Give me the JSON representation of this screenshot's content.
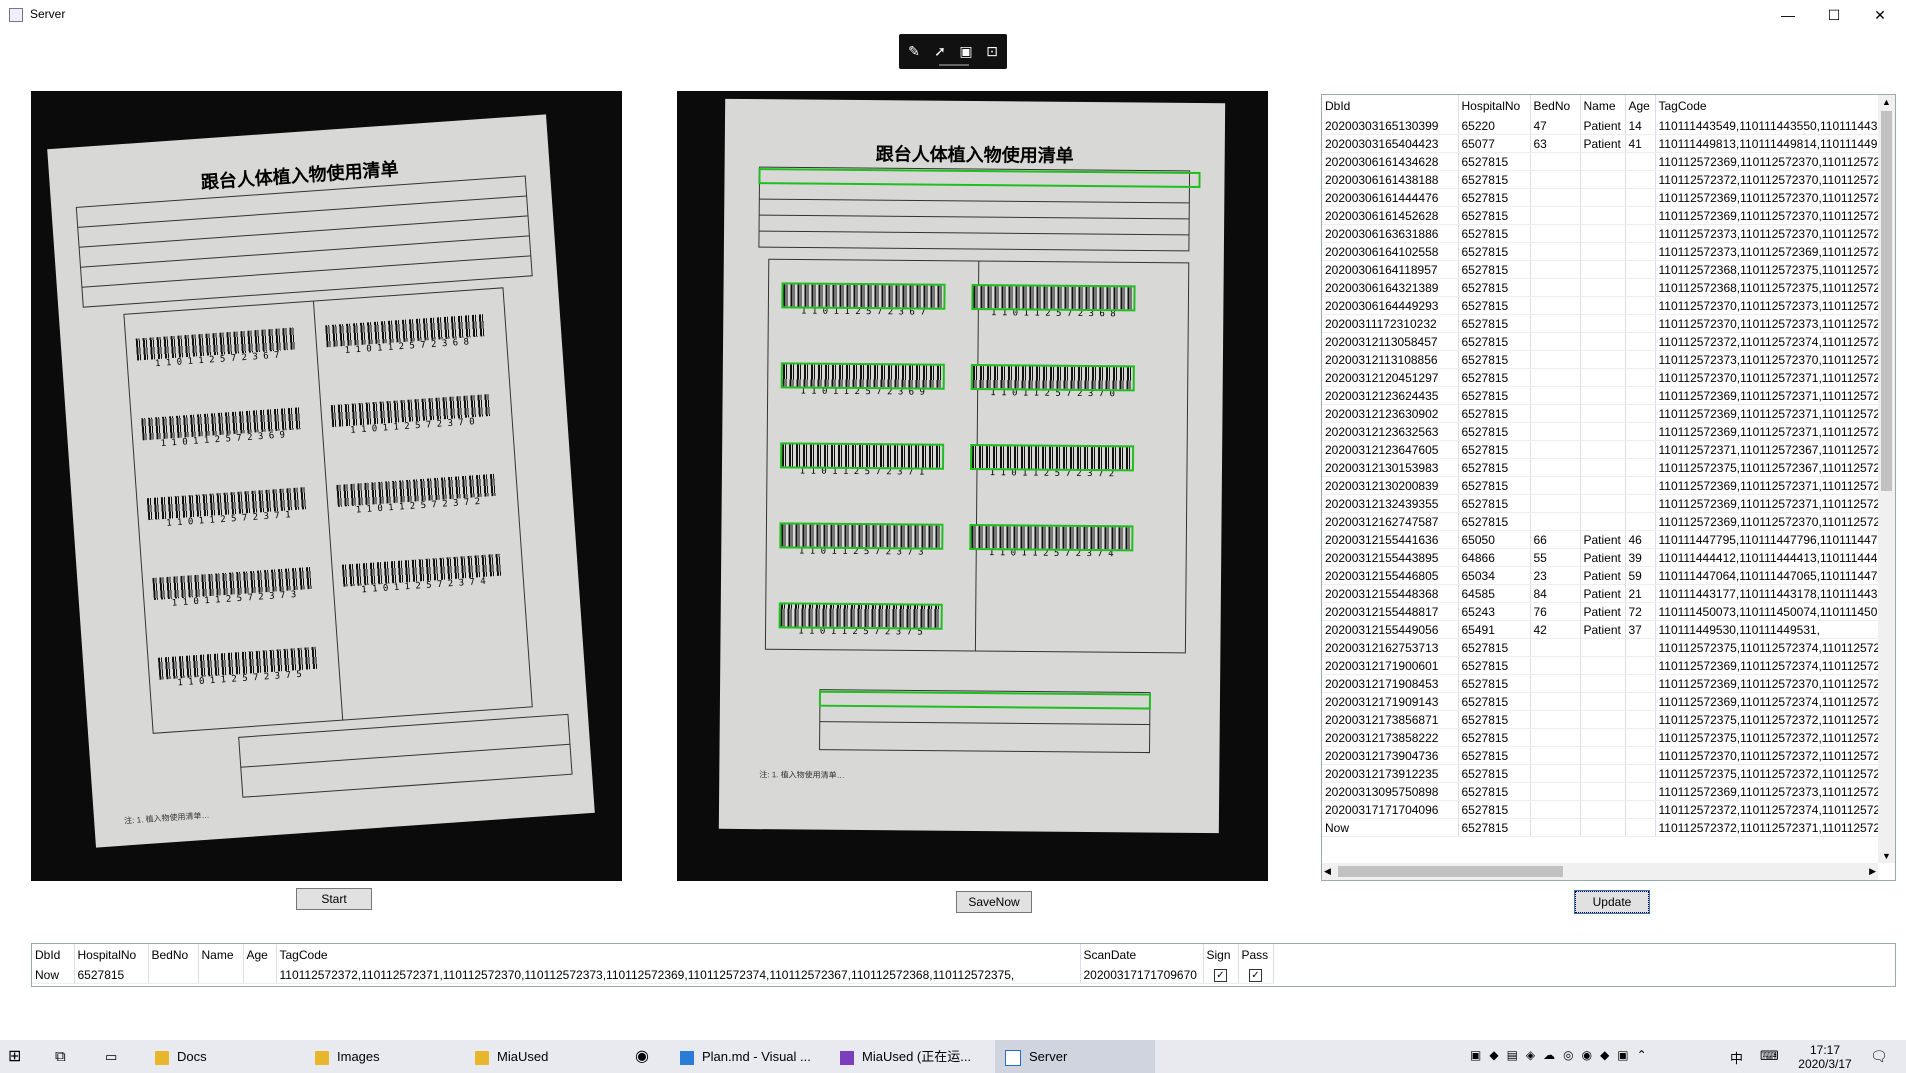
{
  "window": {
    "title": "Server",
    "minimize": "—",
    "maximize": "☐",
    "close": "✕"
  },
  "toolbar": {
    "icons": [
      "edit-doc-icon",
      "select-pointer-icon",
      "frame-icon",
      "presentation-icon"
    ]
  },
  "left_image": {
    "heading": "跟台人体植入物使用清单",
    "barcodes": [
      "1 1 0 1 1 2 5 7 2 3 6 7",
      "1 1 0 1 1 2 5 7 2 3 6 8",
      "1 1 0 1 1 2 5 7 2 3 6 9",
      "1 1 0 1 1 2 5 7 2 3 7 0",
      "1 1 0 1 1 2 5 7 2 3 7 1",
      "1 1 0 1 1 2 5 7 2 3 7 2",
      "1 1 0 1 1 2 5 7 2 3 7 3",
      "1 1 0 1 1 2 5 7 2 3 7 4",
      "1 1 0 1 1 2 5 7 2 3 7 5"
    ]
  },
  "right_image": {
    "heading": "跟台人体植入物使用清单",
    "barcodes": [
      "1 1 0 1 1 2 5 7 2 3 6 7",
      "1 1 0 1 1 2 5 7 2 3 6 8",
      "1 1 0 1 1 2 5 7 2 3 6 9",
      "1 1 0 1 1 2 5 7 2 3 7 0",
      "1 1 0 1 1 2 5 7 2 3 7 1",
      "1 1 0 1 1 2 5 7 2 3 7 2",
      "1 1 0 1 1 2 5 7 2 3 7 3",
      "1 1 0 1 1 2 5 7 2 3 7 4",
      "1 1 0 1 1 2 5 7 2 3 7 5"
    ]
  },
  "buttons": {
    "start": "Start",
    "save_now": "SaveNow",
    "update": "Update"
  },
  "right_grid": {
    "columns": [
      "DbId",
      "HospitalNo",
      "BedNo",
      "Name",
      "Age",
      "TagCode"
    ],
    "rows": [
      [
        "20200303165130399",
        "65220",
        "47",
        "Patient",
        "14",
        "110111443549,110111443550,110111443"
      ],
      [
        "20200303165404423",
        "65077",
        "63",
        "Patient",
        "41",
        "110111449813,110111449814,110111449"
      ],
      [
        "20200306161434628",
        "6527815",
        "",
        "",
        "",
        "110112572369,110112572370,110112572"
      ],
      [
        "20200306161438188",
        "6527815",
        "",
        "",
        "",
        "110112572372,110112572370,110112572"
      ],
      [
        "20200306161444476",
        "6527815",
        "",
        "",
        "",
        "110112572369,110112572370,110112572"
      ],
      [
        "20200306161452628",
        "6527815",
        "",
        "",
        "",
        "110112572369,110112572370,110112572"
      ],
      [
        "20200306163631886",
        "6527815",
        "",
        "",
        "",
        "110112572373,110112572370,110112572"
      ],
      [
        "20200306164102558",
        "6527815",
        "",
        "",
        "",
        "110112572373,110112572369,110112572"
      ],
      [
        "20200306164118957",
        "6527815",
        "",
        "",
        "",
        "110112572368,110112572375,110112572"
      ],
      [
        "20200306164321389",
        "6527815",
        "",
        "",
        "",
        "110112572368,110112572375,110112572"
      ],
      [
        "20200306164449293",
        "6527815",
        "",
        "",
        "",
        "110112572370,110112572373,110112572"
      ],
      [
        "20200311172310232",
        "6527815",
        "",
        "",
        "",
        "110112572370,110112572373,110112572"
      ],
      [
        "20200312113058457",
        "6527815",
        "",
        "",
        "",
        "110112572372,110112572374,110112572"
      ],
      [
        "20200312113108856",
        "6527815",
        "",
        "",
        "",
        "110112572373,110112572370,110112572"
      ],
      [
        "20200312120451297",
        "6527815",
        "",
        "",
        "",
        "110112572370,110112572371,110112572"
      ],
      [
        "20200312123624435",
        "6527815",
        "",
        "",
        "",
        "110112572369,110112572371,110112572"
      ],
      [
        "20200312123630902",
        "6527815",
        "",
        "",
        "",
        "110112572369,110112572371,110112572"
      ],
      [
        "20200312123632563",
        "6527815",
        "",
        "",
        "",
        "110112572369,110112572371,110112572"
      ],
      [
        "20200312123647605",
        "6527815",
        "",
        "",
        "",
        "110112572371,110112572367,110112572"
      ],
      [
        "20200312130153983",
        "6527815",
        "",
        "",
        "",
        "110112572375,110112572367,110112572"
      ],
      [
        "20200312130200839",
        "6527815",
        "",
        "",
        "",
        "110112572369,110112572371,110112572"
      ],
      [
        "20200312132439355",
        "6527815",
        "",
        "",
        "",
        "110112572369,110112572371,110112572"
      ],
      [
        "20200312162747587",
        "6527815",
        "",
        "",
        "",
        "110112572369,110112572370,110112572"
      ],
      [
        "20200312155441636",
        "65050",
        "66",
        "Patient",
        "46",
        "110111447795,110111447796,110111447"
      ],
      [
        "20200312155443895",
        "64866",
        "55",
        "Patient",
        "39",
        "110111444412,110111444413,110111444"
      ],
      [
        "20200312155446805",
        "65034",
        "23",
        "Patient",
        "59",
        "110111447064,110111447065,110111447"
      ],
      [
        "20200312155448368",
        "64585",
        "84",
        "Patient",
        "21",
        "110111443177,110111443178,110111443"
      ],
      [
        "20200312155448817",
        "65243",
        "76",
        "Patient",
        "72",
        "110111450073,110111450074,110111450"
      ],
      [
        "20200312155449056",
        "65491",
        "42",
        "Patient",
        "37",
        "110111449530,110111449531,"
      ],
      [
        "20200312162753713",
        "6527815",
        "",
        "",
        "",
        "110112572375,110112572374,110112572"
      ],
      [
        "20200312171900601",
        "6527815",
        "",
        "",
        "",
        "110112572369,110112572374,110112572"
      ],
      [
        "20200312171908453",
        "6527815",
        "",
        "",
        "",
        "110112572369,110112572370,110112572"
      ],
      [
        "20200312171909143",
        "6527815",
        "",
        "",
        "",
        "110112572369,110112572374,110112572"
      ],
      [
        "20200312173856871",
        "6527815",
        "",
        "",
        "",
        "110112572375,110112572372,110112572"
      ],
      [
        "20200312173858222",
        "6527815",
        "",
        "",
        "",
        "110112572375,110112572372,110112572"
      ],
      [
        "20200312173904736",
        "6527815",
        "",
        "",
        "",
        "110112572370,110112572372,110112572"
      ],
      [
        "20200312173912235",
        "6527815",
        "",
        "",
        "",
        "110112572375,110112572372,110112572"
      ],
      [
        "20200313095750898",
        "6527815",
        "",
        "",
        "",
        "110112572369,110112572373,110112572"
      ],
      [
        "20200317171704096",
        "6527815",
        "",
        "",
        "",
        "110112572372,110112572374,110112572"
      ],
      [
        "Now",
        "6527815",
        "",
        "",
        "",
        "110112572372,110112572371,110112572"
      ]
    ]
  },
  "bottom_grid": {
    "columns": [
      "DbId",
      "HospitalNo",
      "BedNo",
      "Name",
      "Age",
      "TagCode",
      "ScanDate",
      "Sign",
      "Pass"
    ],
    "row": {
      "dbid": "Now",
      "hospital_no": "6527815",
      "bed_no": "",
      "name": "",
      "age": "",
      "tag_code": "110112572372,110112572371,110112572370,110112572373,110112572369,110112572374,110112572367,110112572368,110112572375,",
      "scan_date": "20200317171709670",
      "sign": "✓",
      "pass": "✓"
    }
  },
  "taskbar": {
    "items": [
      {
        "label": "Docs",
        "icon": "folder-icon"
      },
      {
        "label": "Images",
        "icon": "folder-icon"
      },
      {
        "label": "MiaUsed",
        "icon": "folder-icon"
      },
      {
        "label": "Plan.md - Visual ...",
        "icon": "vscode-icon"
      },
      {
        "label": "MiaUsed (正在运...",
        "icon": "visual-studio-icon"
      },
      {
        "label": "Server",
        "icon": "app-window-icon"
      }
    ],
    "time": "17:17",
    "date": "2020/3/17",
    "ime": "中"
  }
}
